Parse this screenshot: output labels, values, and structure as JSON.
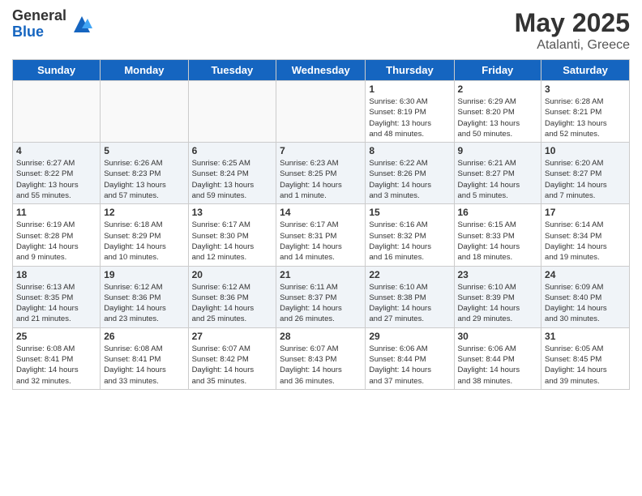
{
  "logo": {
    "general": "General",
    "blue": "Blue"
  },
  "header": {
    "month": "May 2025",
    "location": "Atalanti, Greece"
  },
  "days_of_week": [
    "Sunday",
    "Monday",
    "Tuesday",
    "Wednesday",
    "Thursday",
    "Friday",
    "Saturday"
  ],
  "weeks": [
    [
      {
        "day": "",
        "info": ""
      },
      {
        "day": "",
        "info": ""
      },
      {
        "day": "",
        "info": ""
      },
      {
        "day": "",
        "info": ""
      },
      {
        "day": "1",
        "info": "Sunrise: 6:30 AM\nSunset: 8:19 PM\nDaylight: 13 hours\nand 48 minutes."
      },
      {
        "day": "2",
        "info": "Sunrise: 6:29 AM\nSunset: 8:20 PM\nDaylight: 13 hours\nand 50 minutes."
      },
      {
        "day": "3",
        "info": "Sunrise: 6:28 AM\nSunset: 8:21 PM\nDaylight: 13 hours\nand 52 minutes."
      }
    ],
    [
      {
        "day": "4",
        "info": "Sunrise: 6:27 AM\nSunset: 8:22 PM\nDaylight: 13 hours\nand 55 minutes."
      },
      {
        "day": "5",
        "info": "Sunrise: 6:26 AM\nSunset: 8:23 PM\nDaylight: 13 hours\nand 57 minutes."
      },
      {
        "day": "6",
        "info": "Sunrise: 6:25 AM\nSunset: 8:24 PM\nDaylight: 13 hours\nand 59 minutes."
      },
      {
        "day": "7",
        "info": "Sunrise: 6:23 AM\nSunset: 8:25 PM\nDaylight: 14 hours\nand 1 minute."
      },
      {
        "day": "8",
        "info": "Sunrise: 6:22 AM\nSunset: 8:26 PM\nDaylight: 14 hours\nand 3 minutes."
      },
      {
        "day": "9",
        "info": "Sunrise: 6:21 AM\nSunset: 8:27 PM\nDaylight: 14 hours\nand 5 minutes."
      },
      {
        "day": "10",
        "info": "Sunrise: 6:20 AM\nSunset: 8:27 PM\nDaylight: 14 hours\nand 7 minutes."
      }
    ],
    [
      {
        "day": "11",
        "info": "Sunrise: 6:19 AM\nSunset: 8:28 PM\nDaylight: 14 hours\nand 9 minutes."
      },
      {
        "day": "12",
        "info": "Sunrise: 6:18 AM\nSunset: 8:29 PM\nDaylight: 14 hours\nand 10 minutes."
      },
      {
        "day": "13",
        "info": "Sunrise: 6:17 AM\nSunset: 8:30 PM\nDaylight: 14 hours\nand 12 minutes."
      },
      {
        "day": "14",
        "info": "Sunrise: 6:17 AM\nSunset: 8:31 PM\nDaylight: 14 hours\nand 14 minutes."
      },
      {
        "day": "15",
        "info": "Sunrise: 6:16 AM\nSunset: 8:32 PM\nDaylight: 14 hours\nand 16 minutes."
      },
      {
        "day": "16",
        "info": "Sunrise: 6:15 AM\nSunset: 8:33 PM\nDaylight: 14 hours\nand 18 minutes."
      },
      {
        "day": "17",
        "info": "Sunrise: 6:14 AM\nSunset: 8:34 PM\nDaylight: 14 hours\nand 19 minutes."
      }
    ],
    [
      {
        "day": "18",
        "info": "Sunrise: 6:13 AM\nSunset: 8:35 PM\nDaylight: 14 hours\nand 21 minutes."
      },
      {
        "day": "19",
        "info": "Sunrise: 6:12 AM\nSunset: 8:36 PM\nDaylight: 14 hours\nand 23 minutes."
      },
      {
        "day": "20",
        "info": "Sunrise: 6:12 AM\nSunset: 8:36 PM\nDaylight: 14 hours\nand 25 minutes."
      },
      {
        "day": "21",
        "info": "Sunrise: 6:11 AM\nSunset: 8:37 PM\nDaylight: 14 hours\nand 26 minutes."
      },
      {
        "day": "22",
        "info": "Sunrise: 6:10 AM\nSunset: 8:38 PM\nDaylight: 14 hours\nand 27 minutes."
      },
      {
        "day": "23",
        "info": "Sunrise: 6:10 AM\nSunset: 8:39 PM\nDaylight: 14 hours\nand 29 minutes."
      },
      {
        "day": "24",
        "info": "Sunrise: 6:09 AM\nSunset: 8:40 PM\nDaylight: 14 hours\nand 30 minutes."
      }
    ],
    [
      {
        "day": "25",
        "info": "Sunrise: 6:08 AM\nSunset: 8:41 PM\nDaylight: 14 hours\nand 32 minutes."
      },
      {
        "day": "26",
        "info": "Sunrise: 6:08 AM\nSunset: 8:41 PM\nDaylight: 14 hours\nand 33 minutes."
      },
      {
        "day": "27",
        "info": "Sunrise: 6:07 AM\nSunset: 8:42 PM\nDaylight: 14 hours\nand 35 minutes."
      },
      {
        "day": "28",
        "info": "Sunrise: 6:07 AM\nSunset: 8:43 PM\nDaylight: 14 hours\nand 36 minutes."
      },
      {
        "day": "29",
        "info": "Sunrise: 6:06 AM\nSunset: 8:44 PM\nDaylight: 14 hours\nand 37 minutes."
      },
      {
        "day": "30",
        "info": "Sunrise: 6:06 AM\nSunset: 8:44 PM\nDaylight: 14 hours\nand 38 minutes."
      },
      {
        "day": "31",
        "info": "Sunrise: 6:05 AM\nSunset: 8:45 PM\nDaylight: 14 hours\nand 39 minutes."
      }
    ]
  ]
}
